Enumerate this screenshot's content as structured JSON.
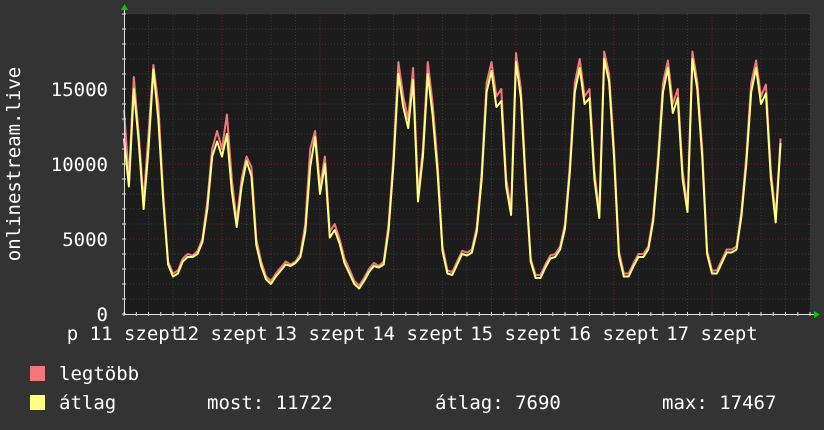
{
  "colors": {
    "background": "#333333",
    "plot_background": "#1c1c1c",
    "grid_minor": "#3a3a3a",
    "grid_major": "#7a1a1a",
    "text": "#ffffff",
    "axis": "#e0e0e0",
    "arrow": "#00cc00",
    "max_series": "#f07878",
    "avg_series": "#ffff80"
  },
  "chart_data": {
    "type": "area",
    "ylabel": "onlinestream.live",
    "ylim": [
      0,
      20000
    ],
    "yticks": [
      0,
      5000,
      10000,
      15000
    ],
    "ytick_labels": [
      "0",
      "5000",
      "10000",
      "15000"
    ],
    "xlim": [
      0,
      7.0
    ],
    "xticks": [
      0,
      1,
      2,
      3,
      4,
      5,
      6
    ],
    "xtick_labels": [
      "p 11 szept",
      "12 szept",
      "13 szept",
      "14 szept",
      "15 szept",
      "16 szept",
      "17 szept"
    ],
    "grid": true,
    "legend_placement": "bottom",
    "x": [
      0.0,
      0.05,
      0.1,
      0.15,
      0.2,
      0.25,
      0.3,
      0.35,
      0.4,
      0.45,
      0.5,
      0.55,
      0.6,
      0.65,
      0.7,
      0.75,
      0.8,
      0.85,
      0.9,
      0.95,
      1.0,
      1.05,
      1.1,
      1.15,
      1.2,
      1.25,
      1.3,
      1.35,
      1.4,
      1.45,
      1.5,
      1.55,
      1.6,
      1.65,
      1.7,
      1.75,
      1.8,
      1.85,
      1.9,
      1.95,
      2.0,
      2.05,
      2.1,
      2.15,
      2.2,
      2.25,
      2.3,
      2.35,
      2.4,
      2.45,
      2.5,
      2.55,
      2.6,
      2.65,
      2.7,
      2.75,
      2.8,
      2.85,
      2.9,
      2.95,
      3.0,
      3.05,
      3.1,
      3.15,
      3.2,
      3.25,
      3.3,
      3.35,
      3.4,
      3.45,
      3.5,
      3.55,
      3.6,
      3.65,
      3.7,
      3.75,
      3.8,
      3.85,
      3.9,
      3.95,
      4.0,
      4.05,
      4.1,
      4.15,
      4.2,
      4.25,
      4.3,
      4.35,
      4.4,
      4.45,
      4.5,
      4.55,
      4.6,
      4.65,
      4.7,
      4.75,
      4.8,
      4.85,
      4.9,
      4.95,
      5.0,
      5.05,
      5.1,
      5.15,
      5.2,
      5.25,
      5.3,
      5.35,
      5.4,
      5.45,
      5.5,
      5.55,
      5.6,
      5.65,
      5.7,
      5.75,
      5.8,
      5.85,
      5.9,
      5.95,
      6.0,
      6.05,
      6.1,
      6.15,
      6.2,
      6.25,
      6.3,
      6.35,
      6.4,
      6.45,
      6.5,
      6.55,
      6.6,
      6.65,
      6.7,
      6.75,
      6.8,
      6.85,
      6.9,
      6.95
    ],
    "series": [
      {
        "name": "legtöbb",
        "values": [
          13600,
          9000,
          15800,
          12000,
          7500,
          12000,
          16600,
          14000,
          8000,
          3500,
          2700,
          2900,
          3700,
          4000,
          3900,
          4200,
          5000,
          7500,
          11000,
          12200,
          11000,
          13300,
          9000,
          6200,
          9000,
          10500,
          9800,
          5000,
          3500,
          2500,
          2200,
          2700,
          3100,
          3500,
          3300,
          3500,
          4000,
          6000,
          11000,
          12200,
          8500,
          10500,
          5500,
          6000,
          5000,
          3700,
          3000,
          2200,
          1900,
          2400,
          3000,
          3400,
          3200,
          3500,
          6000,
          10500,
          16800,
          14500,
          13000,
          16400,
          8000,
          11000,
          16800,
          14000,
          10000,
          4500,
          2900,
          2800,
          3500,
          4200,
          4100,
          4300,
          5800,
          9500,
          15400,
          16800,
          14500,
          15000,
          9000,
          7000,
          17400,
          15000,
          9000,
          3700,
          2600,
          2600,
          3300,
          3900,
          4000,
          4500,
          6000,
          10000,
          15400,
          17000,
          14500,
          15000,
          9500,
          6800,
          17500,
          16000,
          11000,
          4200,
          2700,
          2700,
          3400,
          4000,
          4000,
          4500,
          6500,
          10500,
          15400,
          16900,
          14000,
          15000,
          9500,
          7200,
          17500,
          15500,
          11000,
          4200,
          2900,
          2900,
          3600,
          4300,
          4300,
          4500,
          6800,
          10500,
          15400,
          16900,
          14500,
          15300,
          9600,
          6500,
          11700
        ]
      },
      {
        "name": "átlag",
        "values": [
          11700,
          8500,
          15000,
          11500,
          7000,
          11000,
          16300,
          13000,
          7600,
          3300,
          2500,
          2700,
          3500,
          3800,
          3800,
          4000,
          4800,
          7000,
          10500,
          11500,
          10500,
          12000,
          8200,
          5800,
          8500,
          10200,
          9200,
          4600,
          3200,
          2300,
          2000,
          2500,
          2900,
          3300,
          3200,
          3400,
          3800,
          5500,
          9800,
          11800,
          8000,
          10000,
          5100,
          5600,
          4700,
          3400,
          2700,
          2000,
          1700,
          2200,
          2800,
          3200,
          3100,
          3300,
          5600,
          10000,
          16000,
          13800,
          12400,
          15600,
          7500,
          10500,
          16000,
          13200,
          9400,
          4200,
          2700,
          2600,
          3300,
          4000,
          3900,
          4100,
          5500,
          9000,
          14800,
          16200,
          13800,
          14200,
          8500,
          6600,
          16800,
          14400,
          8500,
          3500,
          2400,
          2400,
          3100,
          3700,
          3800,
          4300,
          5700,
          9500,
          14800,
          16400,
          14000,
          14400,
          9000,
          6400,
          17000,
          15500,
          10500,
          3900,
          2500,
          2500,
          3200,
          3800,
          3800,
          4300,
          6200,
          10000,
          14800,
          16400,
          13400,
          14400,
          9000,
          6800,
          17000,
          15000,
          10500,
          4000,
          2700,
          2700,
          3400,
          4100,
          4100,
          4300,
          6500,
          10000,
          14800,
          16400,
          14000,
          14700,
          9100,
          6100,
          11400
        ]
      }
    ]
  },
  "legend": {
    "max": {
      "label": "legtöbb"
    },
    "avg": {
      "label": "átlag"
    }
  },
  "stats": {
    "current_label": "most:",
    "current_value": "11722",
    "average_label": "átlag:",
    "average_value": "7690",
    "max_label": "max:",
    "max_value": "17467"
  }
}
